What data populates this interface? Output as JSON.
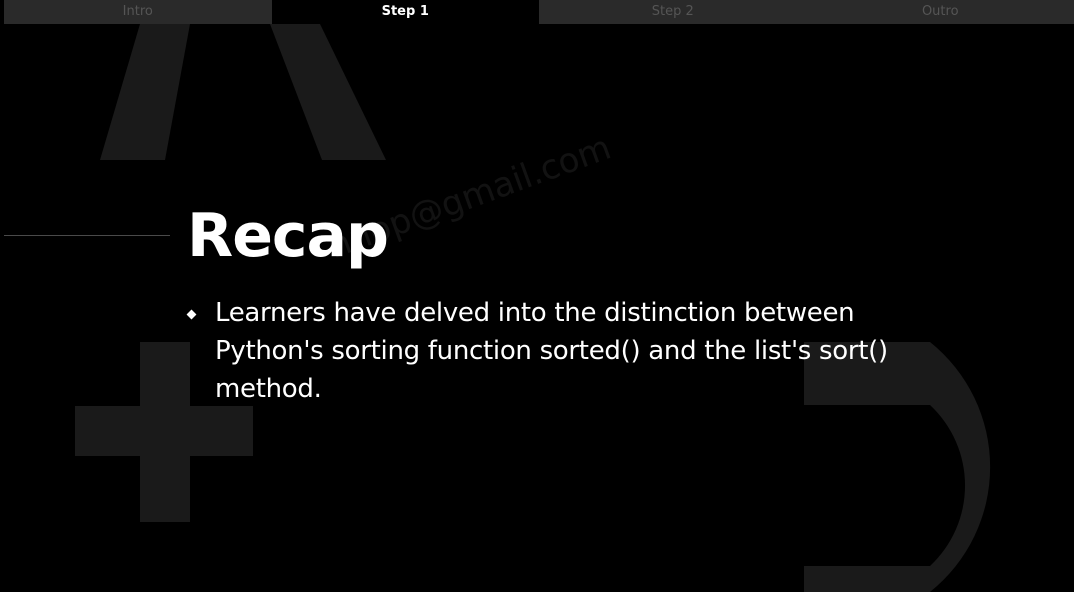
{
  "tabs": [
    {
      "label": "Intro",
      "active": false
    },
    {
      "label": "Step 1",
      "active": true
    },
    {
      "label": "Step 2",
      "active": false
    },
    {
      "label": "Outro",
      "active": false
    }
  ],
  "slide": {
    "title": "Recap",
    "bullets": [
      "Learners have delved into the distinction between Python's sorting function sorted() and the list's sort() method."
    ]
  },
  "watermark": "nnop@gmail.com",
  "colors": {
    "background": "#000000",
    "text": "#ffffff",
    "tab_inactive_bg": "#2a2a2a",
    "tab_inactive_text": "#555555",
    "decoration": "#1a1a1a"
  }
}
